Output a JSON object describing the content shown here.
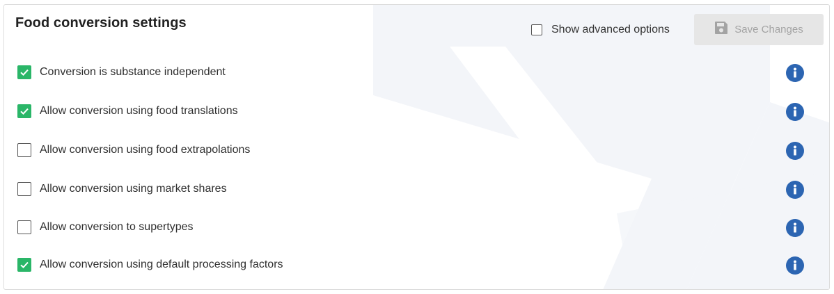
{
  "panel": {
    "title": "Food conversion settings"
  },
  "header": {
    "show_advanced_label": "Show advanced options",
    "show_advanced_checked": false,
    "save_label": "Save Changes",
    "save_enabled": false
  },
  "settings": [
    {
      "label": "Conversion is substance independent",
      "checked": true
    },
    {
      "label": "Allow conversion using food translations",
      "checked": true
    },
    {
      "label": "Allow conversion using food extrapolations",
      "checked": false
    },
    {
      "label": "Allow conversion using market shares",
      "checked": false
    },
    {
      "label": "Allow conversion to supertypes",
      "checked": false
    },
    {
      "label": "Allow conversion using default processing factors",
      "checked": true
    }
  ],
  "icons": {
    "info": "info-icon",
    "check": "check-icon",
    "save": "floppy-disk-icon"
  },
  "colors": {
    "checked": "#2ab668",
    "info": "#2c65b2",
    "button_bg": "#e6e6e6",
    "button_text": "#a3a3a3"
  }
}
